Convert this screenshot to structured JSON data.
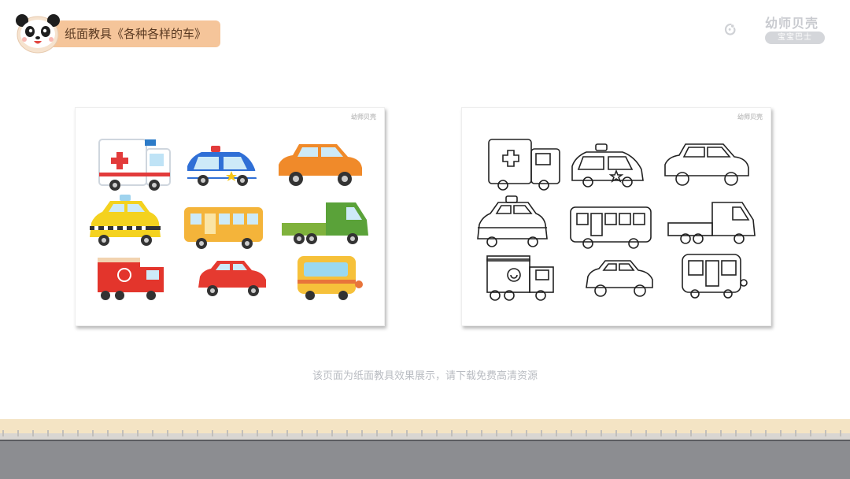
{
  "header": {
    "title": "纸面教具《各种各样的车》"
  },
  "brand": {
    "name": "幼师贝壳",
    "sub": "宝宝巴士"
  },
  "sheets": {
    "left": {
      "logo": "幼师贝壳"
    },
    "right": {
      "logo": "幼师贝壳"
    }
  },
  "caption": "该页面为纸面教具效果展示，请下载免费高清资源",
  "colors": {
    "title_bg": "#f5c59a",
    "title_text": "#5a3a22",
    "sand": "#f4e4c4",
    "road": "#8c8d91"
  },
  "vehicles": [
    "ambulance",
    "police-car",
    "orange-car",
    "taxi",
    "bus",
    "truck",
    "fire-truck",
    "red-car",
    "school-bus"
  ]
}
